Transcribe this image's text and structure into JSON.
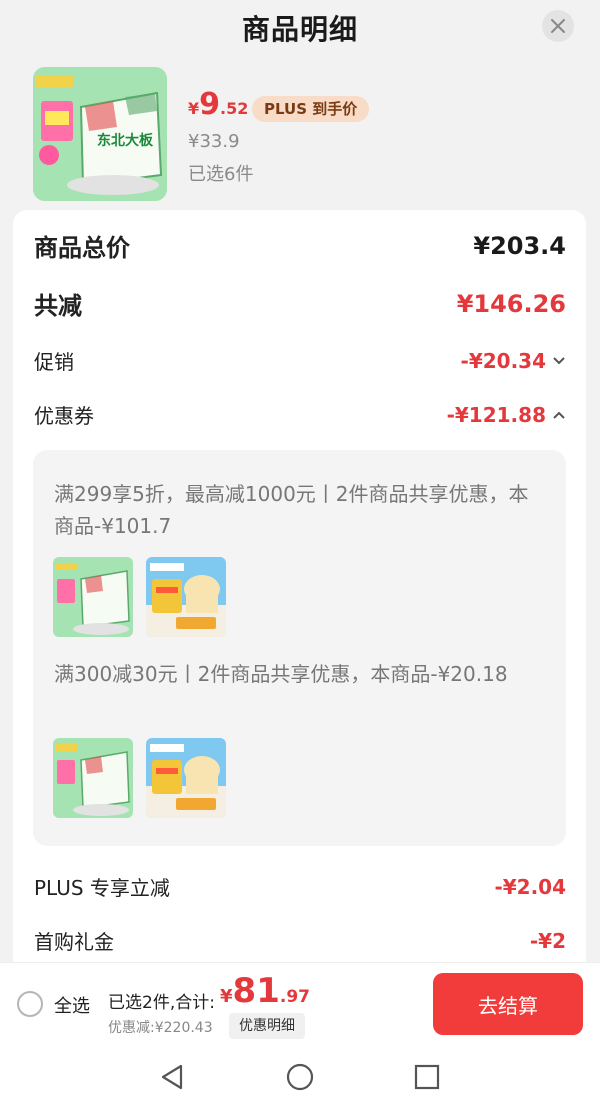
{
  "header": {
    "title": "商品明细"
  },
  "product": {
    "price_yen": "¥",
    "price_int": "9",
    "price_dec": ".52",
    "plus_badge": "PLUS 到手价",
    "original_price": "¥33.9",
    "selected_count": "已选6件",
    "image_text": "东北大板"
  },
  "summary": {
    "total_label": "商品总价",
    "total_value": "¥203.4",
    "reduce_label": "共减",
    "reduce_value": "¥146.26",
    "promo_label": "促销",
    "promo_value": "-¥20.34",
    "coupon_label": "优惠券",
    "coupon_value": "-¥121.88"
  },
  "coupons": [
    {
      "desc": "满299享5折，最高减1000元丨2件商品共享优惠，本商品-¥101.7"
    },
    {
      "desc": "满300减30元丨2件商品共享优惠，本商品-¥20.18"
    }
  ],
  "extra": {
    "plus_label": "PLUS 专享立减",
    "plus_value": "-¥2.04",
    "first_label": "首购礼金",
    "first_value": "-¥2"
  },
  "bottom": {
    "select_all": "全选",
    "selected_summary": "已选2件,合计:",
    "sum_yen": "¥",
    "sum_int": "81",
    "sum_dec": ".97",
    "discount_label": "优惠减:¥220.43",
    "detail_button": "优惠明细",
    "checkout_button": "去结算"
  },
  "colors": {
    "accent": "#e4393c",
    "checkout": "#f23b3b",
    "plus_badge_bg": "#f8dcc8"
  }
}
